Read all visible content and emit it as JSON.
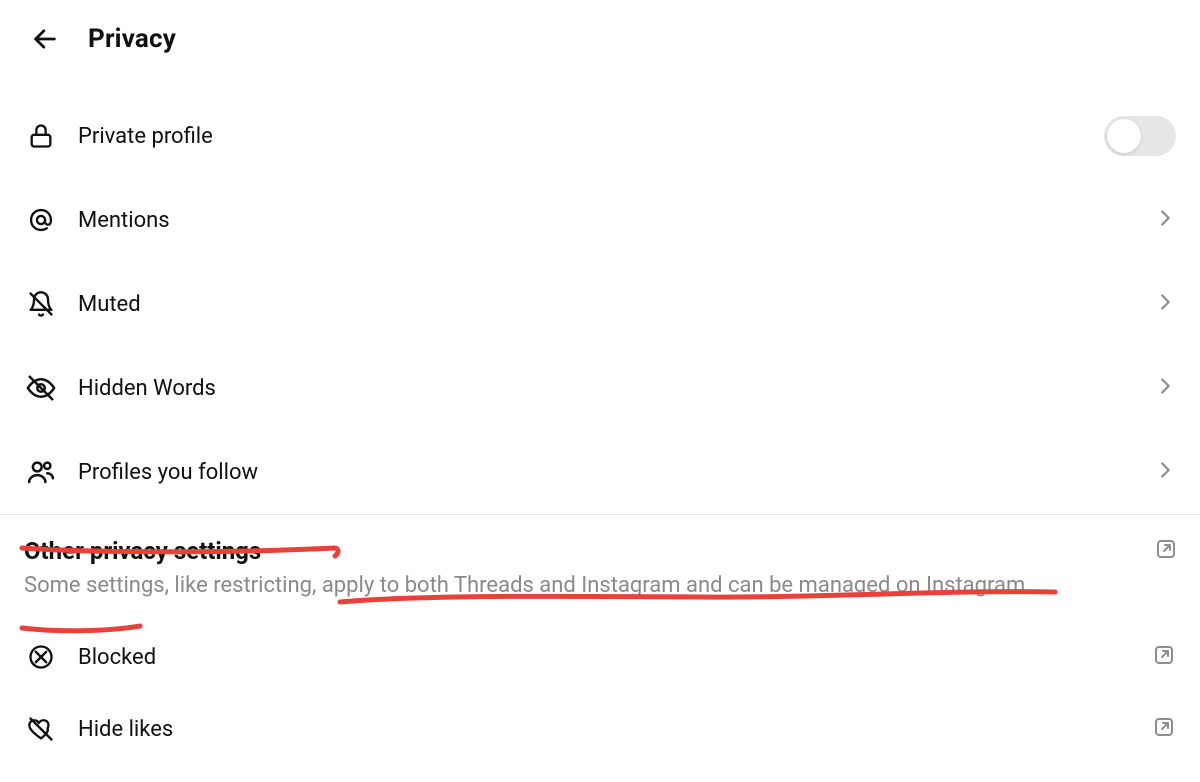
{
  "header": {
    "title": "Privacy"
  },
  "items": {
    "private_profile": {
      "label": "Private profile",
      "toggle_on": false
    },
    "mentions": {
      "label": "Mentions"
    },
    "muted": {
      "label": "Muted"
    },
    "hidden_words": {
      "label": "Hidden Words"
    },
    "profiles_follow": {
      "label": "Profiles you follow"
    }
  },
  "other_section": {
    "title": "Other privacy settings",
    "subtitle": "Some settings, like restricting, apply to both Threads and Instagram and can be managed on Instagram."
  },
  "other_items": {
    "blocked": {
      "label": "Blocked"
    },
    "hide_likes": {
      "label": "Hide likes"
    }
  }
}
